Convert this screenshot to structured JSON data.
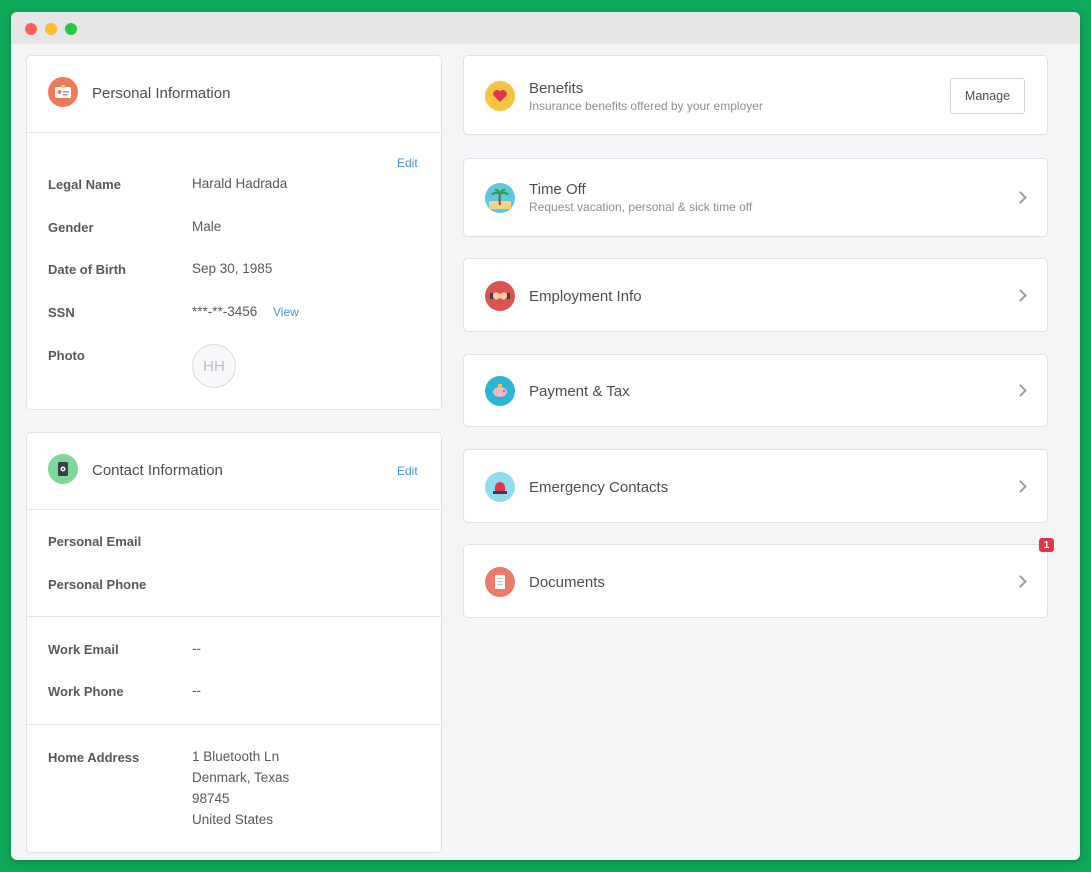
{
  "personal": {
    "title": "Personal Information",
    "edit_label": "Edit",
    "rows": [
      {
        "label": "Legal Name",
        "value": "Harald Hadrada"
      },
      {
        "label": "Gender",
        "value": "Male"
      },
      {
        "label": "Date of Birth",
        "value": "Sep 30, 1985"
      },
      {
        "label": "SSN",
        "value": "***-**-3456"
      },
      {
        "label": "Photo",
        "value": ""
      }
    ],
    "ssn_view_label": "View",
    "avatar_initials": "HH"
  },
  "contact": {
    "title": "Contact Information",
    "edit_label": "Edit",
    "personal_email_label": "Personal Email",
    "personal_phone_label": "Personal Phone",
    "work_email_label": "Work Email",
    "work_email_value": "--",
    "work_phone_label": "Work Phone",
    "work_phone_value": "--",
    "home_address_label": "Home Address",
    "address_lines": [
      "1 Bluetooth Ln",
      "Denmark, Texas",
      "98745",
      "United States"
    ]
  },
  "right": {
    "benefits": {
      "title": "Benefits",
      "subtitle": "Insurance benefits offered by your employer",
      "button": "Manage"
    },
    "time_off": {
      "title": "Time Off",
      "subtitle": "Request vacation, personal & sick time off"
    },
    "employment": {
      "title": "Employment Info"
    },
    "payment": {
      "title": "Payment & Tax"
    },
    "emergency": {
      "title": "Emergency Contacts"
    },
    "documents": {
      "title": "Documents",
      "badge": "1"
    }
  },
  "colors": {
    "background": "#0fa95a",
    "link": "#4a8fd9",
    "badge": "#e0354c"
  }
}
